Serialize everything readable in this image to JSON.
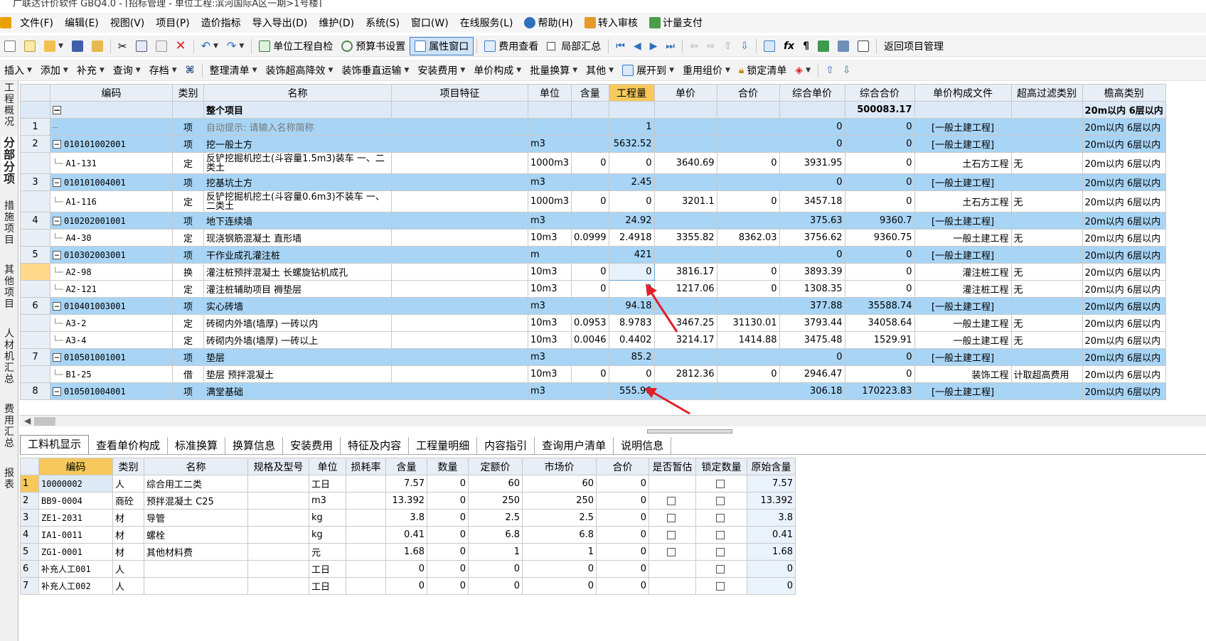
{
  "window": {
    "title": "广联达计价软件 GBQ4.0 - [招标管理 - 单位工程:滨河国际A区一期>1号楼]"
  },
  "menu": [
    "文件(F)",
    "编辑(E)",
    "视图(V)",
    "项目(P)",
    "造价指标",
    "导入导出(D)",
    "维护(D)",
    "系统(S)",
    "窗口(W)",
    "在线服务(L)",
    "帮助(H)",
    "转入审核",
    "计量支付"
  ],
  "toolbar1": {
    "self_check": "单位工程自检",
    "budget_settings": "预算书设置",
    "property_window": "属性窗口",
    "fee_view": "费用查看",
    "partial_summary": "局部汇总",
    "return_project": "返回项目管理"
  },
  "toolbar2": [
    "插入",
    "添加",
    "补充",
    "查询",
    "存档",
    "整理清单",
    "装饰超高降效",
    "装饰垂直运输",
    "安装费用",
    "单价构成",
    "批量换算",
    "其他",
    "展开到",
    "重用组价",
    "锁定清单"
  ],
  "side_tabs": [
    "工程概况",
    "分部分项",
    "措施项目",
    "其他项目",
    "人材机汇总",
    "费用汇总",
    "报表"
  ],
  "top_grid": {
    "headers": [
      "编码",
      "类别",
      "名称",
      "项目特征",
      "单位",
      "含量",
      "工程量",
      "单价",
      "合价",
      "综合单价",
      "综合合价",
      "单价构成文件",
      "超高过滤类别",
      "檐高类别"
    ],
    "summary": {
      "toggle": "−",
      "name": "整个项目",
      "total": "500083.17",
      "eaves": "20m以内 6层以内"
    },
    "rows": [
      {
        "rn": "1",
        "kind": "q",
        "code": "",
        "cat": "项",
        "name": "自动提示: 请输入名称简称",
        "unit": "",
        "qty_rate": "",
        "qty": "1",
        "price": "",
        "amount": "",
        "unit_total": "0",
        "total": "0",
        "file": "[一般土建工程]",
        "filter": "",
        "eaves": "20m以内 6层以内"
      },
      {
        "rn": "2",
        "kind": "q",
        "code": "010101002001",
        "cat": "项",
        "name": "挖一般土方",
        "unit": "m3",
        "qty_rate": "",
        "qty": "5632.52",
        "price": "",
        "amount": "",
        "unit_total": "0",
        "total": "0",
        "file": "[一般土建工程]",
        "filter": "",
        "eaves": "20m以内 6层以内"
      },
      {
        "rn": "",
        "kind": "d",
        "code": "A1-131",
        "cat": "定",
        "name": "反铲挖掘机挖土(斗容量1.5m3)装车 一、二类土",
        "unit": "1000m3",
        "qty_rate": "0",
        "qty": "0",
        "price": "3640.69",
        "amount": "0",
        "unit_total": "3931.95",
        "total": "0",
        "file": "土石方工程",
        "filter": "无",
        "eaves": "20m以内 6层以内"
      },
      {
        "rn": "3",
        "kind": "q",
        "code": "010101004001",
        "cat": "项",
        "name": "挖基坑土方",
        "unit": "m3",
        "qty_rate": "",
        "qty": "2.45",
        "price": "",
        "amount": "",
        "unit_total": "0",
        "total": "0",
        "file": "[一般土建工程]",
        "filter": "",
        "eaves": "20m以内 6层以内"
      },
      {
        "rn": "",
        "kind": "d",
        "code": "A1-116",
        "cat": "定",
        "name": "反铲挖掘机挖土(斗容量0.6m3)不装车 一、二类土",
        "unit": "1000m3",
        "qty_rate": "0",
        "qty": "0",
        "price": "3201.1",
        "amount": "0",
        "unit_total": "3457.18",
        "total": "0",
        "file": "土石方工程",
        "filter": "无",
        "eaves": "20m以内 6层以内"
      },
      {
        "rn": "4",
        "kind": "q",
        "code": "010202001001",
        "cat": "项",
        "name": "地下连续墙",
        "unit": "m3",
        "qty_rate": "",
        "qty": "24.92",
        "price": "",
        "amount": "",
        "unit_total": "375.63",
        "total": "9360.7",
        "file": "[一般土建工程]",
        "filter": "",
        "eaves": "20m以内 6层以内"
      },
      {
        "rn": "",
        "kind": "d",
        "code": "A4-30",
        "cat": "定",
        "name": "现浇钢筋混凝土 直形墙",
        "unit": "10m3",
        "qty_rate": "0.0999",
        "qty": "2.4918",
        "price": "3355.82",
        "amount": "8362.03",
        "unit_total": "3756.62",
        "total": "9360.75",
        "file": "一般土建工程",
        "filter": "无",
        "eaves": "20m以内 6层以内"
      },
      {
        "rn": "5",
        "kind": "q",
        "code": "010302003001",
        "cat": "项",
        "name": "干作业成孔灌注桩",
        "unit": "m",
        "qty_rate": "",
        "qty": "421",
        "price": "",
        "amount": "",
        "unit_total": "0",
        "total": "0",
        "file": "[一般土建工程]",
        "filter": "",
        "eaves": "20m以内 6层以内"
      },
      {
        "rn": "",
        "kind": "d",
        "code": "A2-98",
        "cat": "换",
        "name": "灌注桩预拌混凝土 长螺旋钻机成孔",
        "unit": "10m3",
        "qty_rate": "0",
        "qty": "0",
        "price": "3816.17",
        "amount": "0",
        "unit_total": "3893.39",
        "total": "0",
        "file": "灌注桩工程",
        "filter": "无",
        "eaves": "20m以内 6层以内"
      },
      {
        "rn": "",
        "kind": "d",
        "code": "A2-121",
        "cat": "定",
        "name": "灌注桩辅助项目 褥垫层",
        "unit": "10m3",
        "qty_rate": "0",
        "qty": "0",
        "price": "1217.06",
        "amount": "0",
        "unit_total": "1308.35",
        "total": "0",
        "file": "灌注桩工程",
        "filter": "无",
        "eaves": "20m以内 6层以内"
      },
      {
        "rn": "6",
        "kind": "q",
        "code": "010401003001",
        "cat": "项",
        "name": "实心砖墙",
        "unit": "m3",
        "qty_rate": "",
        "qty": "94.18",
        "price": "",
        "amount": "",
        "unit_total": "377.88",
        "total": "35588.74",
        "file": "[一般土建工程]",
        "filter": "",
        "eaves": "20m以内 6层以内"
      },
      {
        "rn": "",
        "kind": "d",
        "code": "A3-2",
        "cat": "定",
        "name": "砖砌内外墙(墙厚) 一砖以内",
        "unit": "10m3",
        "qty_rate": "0.0953",
        "qty": "8.9783",
        "price": "3467.25",
        "amount": "31130.01",
        "unit_total": "3793.44",
        "total": "34058.64",
        "file": "一般土建工程",
        "filter": "无",
        "eaves": "20m以内 6层以内"
      },
      {
        "rn": "",
        "kind": "d",
        "code": "A3-4",
        "cat": "定",
        "name": "砖砌内外墙(墙厚) 一砖以上",
        "unit": "10m3",
        "qty_rate": "0.0046",
        "qty": "0.4402",
        "price": "3214.17",
        "amount": "1414.88",
        "unit_total": "3475.48",
        "total": "1529.91",
        "file": "一般土建工程",
        "filter": "无",
        "eaves": "20m以内 6层以内"
      },
      {
        "rn": "7",
        "kind": "q",
        "code": "010501001001",
        "cat": "项",
        "name": "垫层",
        "unit": "m3",
        "qty_rate": "",
        "qty": "85.2",
        "price": "",
        "amount": "",
        "unit_total": "0",
        "total": "0",
        "file": "[一般土建工程]",
        "filter": "",
        "eaves": "20m以内 6层以内"
      },
      {
        "rn": "",
        "kind": "d",
        "code": "B1-25",
        "cat": "借",
        "name": "垫层 预拌混凝土",
        "unit": "10m3",
        "qty_rate": "0",
        "qty": "0",
        "price": "2812.36",
        "amount": "0",
        "unit_total": "2946.47",
        "total": "0",
        "file": "装饰工程",
        "filter": "计取超高费用",
        "eaves": "20m以内 6层以内"
      },
      {
        "rn": "8",
        "kind": "q",
        "code": "010501004001",
        "cat": "项",
        "name": "满堂基础",
        "unit": "m3",
        "qty_rate": "",
        "qty": "555.96",
        "price": "",
        "amount": "",
        "unit_total": "306.18",
        "total": "170223.83",
        "file": "[一般土建工程]",
        "filter": "",
        "eaves": "20m以内 6层以内"
      }
    ]
  },
  "bottom_tabs": [
    "工料机显示",
    "查看单价构成",
    "标准换算",
    "换算信息",
    "安装费用",
    "特征及内容",
    "工程量明细",
    "内容指引",
    "查询用户清单",
    "说明信息"
  ],
  "bottom_grid": {
    "headers": [
      "编码",
      "类别",
      "名称",
      "规格及型号",
      "单位",
      "损耗率",
      "含量",
      "数量",
      "定额价",
      "市场价",
      "合价",
      "是否暂估",
      "锁定数量",
      "原始含量"
    ],
    "rows": [
      {
        "rn": "1",
        "code": "10000002",
        "cat": "人",
        "name": "综合用工二类",
        "spec": "",
        "unit": "工日",
        "loss": "",
        "rate": "7.57",
        "num": "0",
        "base": "60",
        "market": "60",
        "amount": "0",
        "est": false,
        "lock": true,
        "orig": "7.57"
      },
      {
        "rn": "2",
        "code": "BB9-0004",
        "cat": "商砼",
        "name": "预拌混凝土 C25",
        "spec": "",
        "unit": "m3",
        "loss": "",
        "rate": "13.392",
        "num": "0",
        "base": "250",
        "market": "250",
        "amount": "0",
        "est": true,
        "lock": true,
        "orig": "13.392"
      },
      {
        "rn": "3",
        "code": "ZE1-2031",
        "cat": "材",
        "name": "导管",
        "spec": "",
        "unit": "kg",
        "loss": "",
        "rate": "3.8",
        "num": "0",
        "base": "2.5",
        "market": "2.5",
        "amount": "0",
        "est": true,
        "lock": true,
        "orig": "3.8"
      },
      {
        "rn": "4",
        "code": "IA1-0011",
        "cat": "材",
        "name": "螺栓",
        "spec": "",
        "unit": "kg",
        "loss": "",
        "rate": "0.41",
        "num": "0",
        "base": "6.8",
        "market": "6.8",
        "amount": "0",
        "est": true,
        "lock": true,
        "orig": "0.41"
      },
      {
        "rn": "5",
        "code": "ZG1-0001",
        "cat": "材",
        "name": "其他材料费",
        "spec": "",
        "unit": "元",
        "loss": "",
        "rate": "1.68",
        "num": "0",
        "base": "1",
        "market": "1",
        "amount": "0",
        "est": true,
        "lock": true,
        "orig": "1.68"
      },
      {
        "rn": "6",
        "code": "补充人工001",
        "cat": "人",
        "name": "",
        "spec": "",
        "unit": "工日",
        "loss": "",
        "rate": "0",
        "num": "0",
        "base": "0",
        "market": "0",
        "amount": "0",
        "est": false,
        "lock": true,
        "orig": "0"
      },
      {
        "rn": "7",
        "code": "补充人工002",
        "cat": "人",
        "name": "",
        "spec": "",
        "unit": "工日",
        "loss": "",
        "rate": "0",
        "num": "0",
        "base": "0",
        "market": "0",
        "amount": "0",
        "est": false,
        "lock": true,
        "orig": "0"
      }
    ]
  },
  "colors": {
    "accent": "#3b7cc4",
    "header_bg": "#e8eef6",
    "list_row": "#a8d4f5",
    "highlight": "#f7c95c",
    "annotation": "#e0202a"
  }
}
